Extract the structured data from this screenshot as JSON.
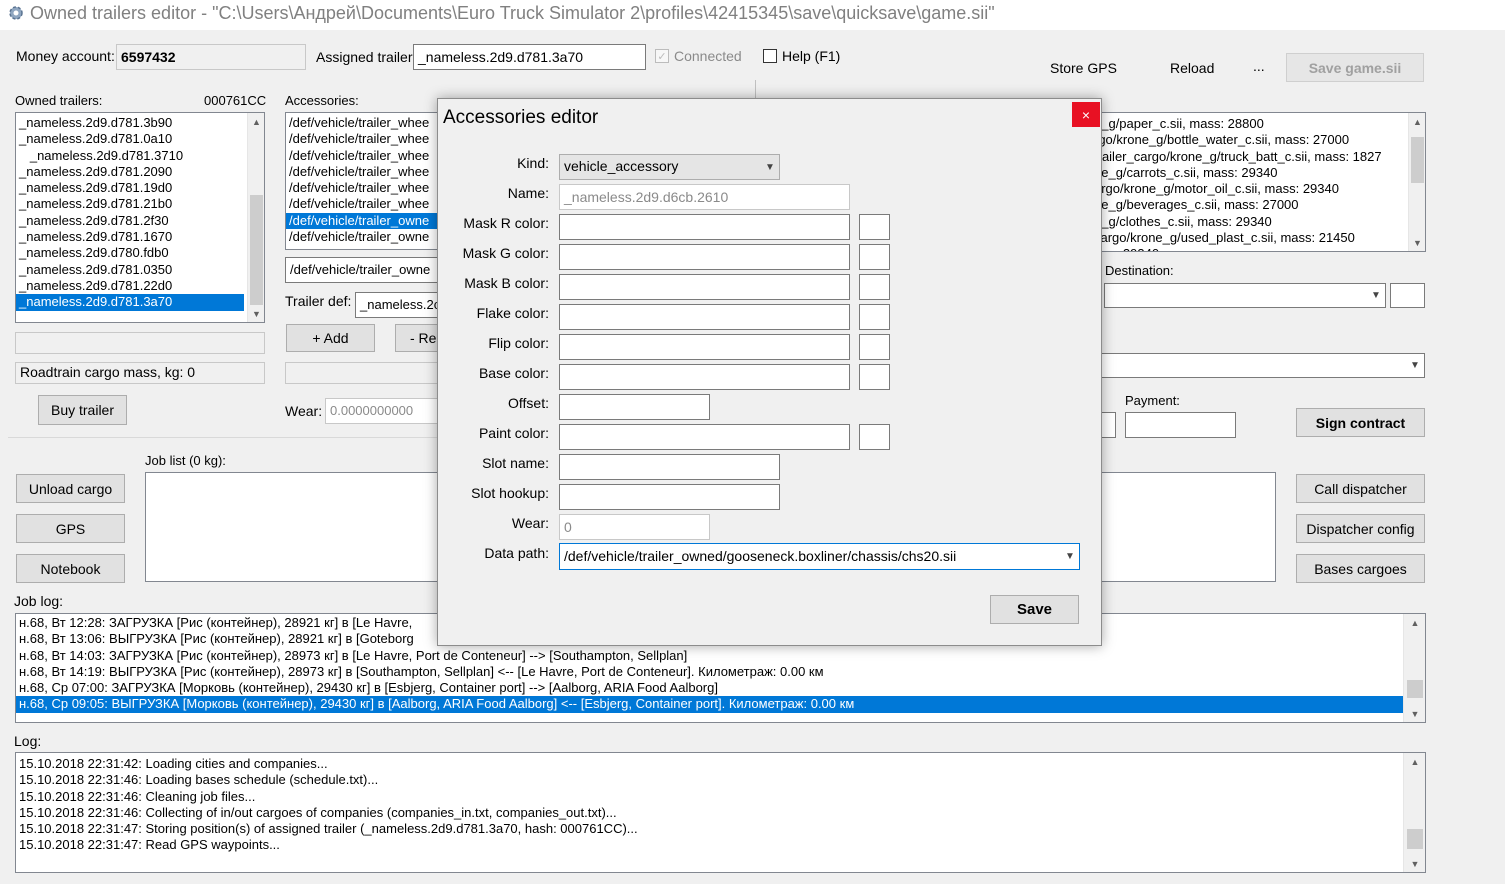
{
  "window": {
    "title": "Owned trailers editor - \"C:\\Users\\Андрей\\Documents\\Euro Truck Simulator 2\\profiles\\42415345\\save\\quicksave\\game.sii\""
  },
  "top": {
    "money_label": "Money account:",
    "money_value": "6597432",
    "assigned_label": "Assigned trailer:",
    "assigned_value": "_nameless.2d9.d781.3a70",
    "connected_label": "Connected",
    "help_label": "Help (F1)",
    "store_gps": "Store GPS",
    "reload": "Reload",
    "ellipsis": "...",
    "save_game": "Save game.sii"
  },
  "owned": {
    "label": "Owned trailers:",
    "hash": "000761CC",
    "items": [
      "_nameless.2d9.d781.3b90",
      "_nameless.2d9.d781.0a10",
      "   _nameless.2d9.d781.3710",
      "_nameless.2d9.d781.2090",
      "_nameless.2d9.d781.19d0",
      "_nameless.2d9.d781.21b0",
      "_nameless.2d9.d781.2f30",
      "_nameless.2d9.d781.1670",
      "_nameless.2d9.d780.fdb0",
      "_nameless.2d9.d781.0350",
      "_nameless.2d9.d781.22d0",
      "_nameless.2d9.d781.3a70"
    ],
    "selected_index": 11,
    "roadtrain_label": "Roadtrain cargo mass, kg: 0",
    "buy_trailer": "Buy trailer"
  },
  "accessories": {
    "label": "Accessories:",
    "items": [
      "/def/vehicle/trailer_whee",
      "/def/vehicle/trailer_whee",
      "/def/vehicle/trailer_whee",
      "/def/vehicle/trailer_whee",
      "/def/vehicle/trailer_whee",
      "/def/vehicle/trailer_whee",
      "/def/vehicle/trailer_owne",
      "/def/vehicle/trailer_owne"
    ],
    "selected_index": 6,
    "path_value": "/def/vehicle/trailer_owne",
    "trailer_def_label": "Trailer def:",
    "trailer_def_value": "_nameless.2c",
    "add_button": "+ Add",
    "remove_button": "- Re",
    "wear_label": "Wear:",
    "wear_value": "0.0000000000"
  },
  "right": {
    "cargo_items": [
      "e_g/paper_c.sii, mass: 28800",
      "rgo/krone_g/bottle_water_c.sii, mass: 27000",
      "trailer_cargo/krone_g/truck_batt_c.sii, mass: 1827",
      "ne_g/carrots_c.sii, mass: 29340",
      "argo/krone_g/motor_oil_c.sii, mass: 29340",
      "ne_g/beverages_c.sii, mass: 27000",
      "e_g/clothes_c.sii, mass: 29340",
      "cargo/krone_g/used_plast_c.sii, mass: 21450",
      "        29340"
    ],
    "destination_label": "Destination:",
    "payment_label": "Payment:",
    "sign_contract": "Sign contract",
    "call_dispatcher": "Call dispatcher",
    "dispatcher_config": "Dispatcher config",
    "bases_cargoes": "Bases cargoes"
  },
  "jobs": {
    "label": "Job list (0 kg):",
    "unload_cargo": "Unload cargo",
    "gps": "GPS",
    "notebook": "Notebook"
  },
  "job_log": {
    "label": "Job log:",
    "rows": [
      "н.68, Вт 12:28: ЗАГРУЗКА [Рис (контейнер), 28921 кг] в [Le Havre,",
      "н.68, Вт 13:06: ВЫГРУЗКА [Рис (контейнер), 28921 кг] в [Goteborg",
      "н.68, Вт 14:03: ЗАГРУЗКА [Рис (контейнер), 28973 кг] в [Le Havre, Port de Conteneur] --> [Southampton, Sellplan]",
      "н.68, Вт 14:19: ВЫГРУЗКА [Рис (контейнер), 28973 кг] в [Southampton, Sellplan] <-- [Le Havre, Port de Conteneur]. Километраж: 0.00 км",
      "н.68, Ср 07:00: ЗАГРУЗКА [Морковь (контейнер), 29430 кг] в [Esbjerg, Container port] --> [Aalborg, ARIA Food Aalborg]",
      "н.68, Ср 09:05: ВЫГРУЗКА [Морковь (контейнер), 29430 кг] в [Aalborg, ARIA Food Aalborg] <-- [Esbjerg, Container port]. Километраж: 0.00 км"
    ],
    "selected_index": 5
  },
  "log": {
    "label": "Log:",
    "rows": [
      "15.10.2018 22:31:42: Loading cities and companies...",
      "15.10.2018 22:31:46: Loading bases schedule (schedule.txt)...",
      "15.10.2018 22:31:46: Cleaning job files...",
      "15.10.2018 22:31:46: Collecting of in/out cargoes of companies (companies_in.txt, companies_out.txt)...",
      "15.10.2018 22:31:47: Storing position(s) of assigned trailer (_nameless.2d9.d781.3a70, hash: 000761CC)...",
      "15.10.2018 22:31:47: Read GPS waypoints..."
    ]
  },
  "dialog": {
    "title": "Accessories editor",
    "close": "×",
    "kind_label": "Kind:",
    "kind_value": "vehicle_accessory",
    "name_label": "Name:",
    "name_value": "_nameless.2d9.d6cb.2610",
    "mask_r_label": "Mask R color:",
    "mask_g_label": "Mask G color:",
    "mask_b_label": "Mask B color:",
    "flake_label": "Flake color:",
    "flip_label": "Flip color:",
    "base_label": "Base color:",
    "offset_label": "Offset:",
    "paint_label": "Paint color:",
    "slot_name_label": "Slot name:",
    "slot_hookup_label": "Slot hookup:",
    "wear_label": "Wear:",
    "wear_value": "0",
    "data_path_label": "Data path:",
    "data_path_value": "/def/vehicle/trailer_owned/gooseneck.boxliner/chassis/chs20.sii",
    "save": "Save"
  },
  "colors": {
    "selection": "#0078d7",
    "close_red": "#e81123",
    "window_bg": "#f0f0f0"
  }
}
